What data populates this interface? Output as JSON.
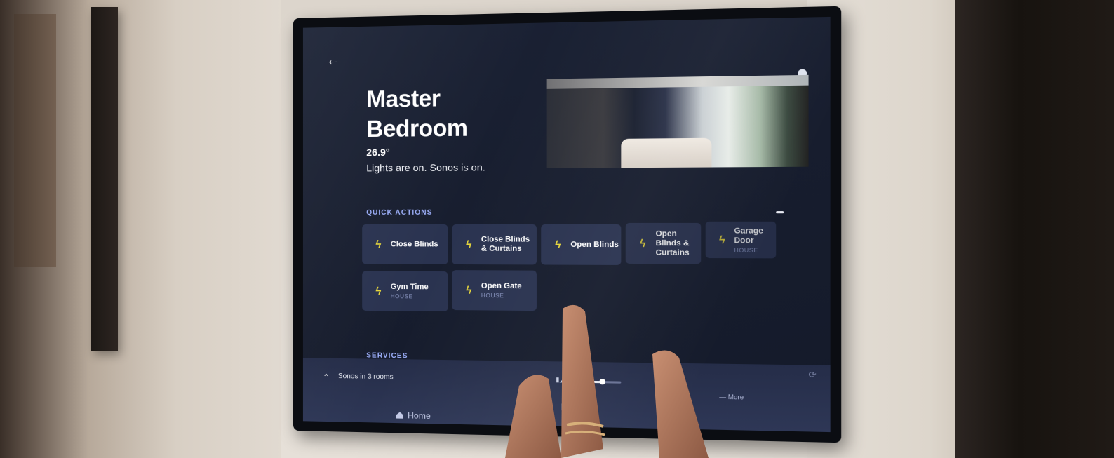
{
  "screen": {
    "room_title": "Master Bedroom",
    "temperature": "26.9°",
    "status": "Lights are on. Sonos is on.",
    "back_icon": "arrow-left-icon",
    "quick_actions_label": "QUICK ACTIONS",
    "services_label": "SERVICES",
    "quick_actions": [
      {
        "label": "Close Blinds",
        "sub": ""
      },
      {
        "label": "Close Blinds & Curtains",
        "sub": ""
      },
      {
        "label": "Open Blinds",
        "sub": ""
      },
      {
        "label": "Open Blinds & Curtains",
        "sub": ""
      },
      {
        "label": "Garage Door",
        "sub": "HOUSE"
      },
      {
        "label": "Gym Time",
        "sub": "HOUSE"
      },
      {
        "label": "Open Gate",
        "sub": "HOUSE"
      }
    ],
    "bottom_bar": {
      "media_status": "Sonos in 3 rooms",
      "more_label": "— More",
      "home_tab": "Home"
    }
  },
  "colors": {
    "screen_bg": "#171d2e",
    "tile_bg": "#2a3350",
    "bolt_icon": "#e6d63b",
    "section_label": "#9fb2ff"
  }
}
